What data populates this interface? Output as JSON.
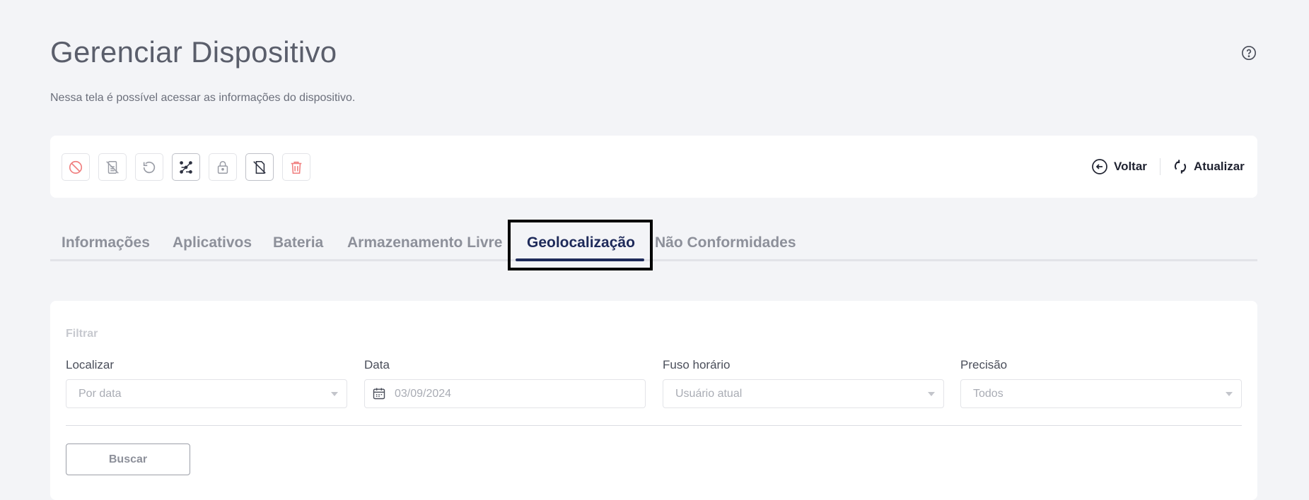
{
  "header": {
    "title": "Gerenciar Dispositivo",
    "subtitle": "Nessa tela é possível acessar as informações do dispositivo.",
    "help_icon": "question-circle-icon"
  },
  "toolbar": {
    "actions": [
      {
        "icon": "block-icon",
        "color": "#f07f7f"
      },
      {
        "icon": "device-off-icon",
        "color": "#9a9da6"
      },
      {
        "icon": "undo-icon",
        "color": "#9a9da6"
      },
      {
        "icon": "pattern-icon",
        "color": "#2d3140"
      },
      {
        "icon": "lock-icon",
        "color": "#9a9da6"
      },
      {
        "icon": "sim-off-icon",
        "color": "#2d3140"
      },
      {
        "icon": "trash-icon",
        "color": "#f07f7f"
      }
    ],
    "back_label": "Voltar",
    "refresh_label": "Atualizar"
  },
  "tabs": [
    {
      "label": "Informações",
      "active": false
    },
    {
      "label": "Aplicativos",
      "active": false
    },
    {
      "label": "Bateria",
      "active": false
    },
    {
      "label": "Armazenamento Livre",
      "active": false
    },
    {
      "label": "Geolocalização",
      "active": true
    },
    {
      "label": "Não Conformidades",
      "active": false
    }
  ],
  "filter": {
    "heading": "Filtrar",
    "fields": [
      {
        "label": "Localizar",
        "value": "Por data"
      },
      {
        "label": "Data",
        "value": "03/09/2024"
      },
      {
        "label": "Fuso horário",
        "value": "Usuário atual"
      },
      {
        "label": "Precisão",
        "value": "Todos"
      }
    ],
    "search_label": "Buscar"
  },
  "colors": {
    "accent": "#1e2a5a",
    "danger": "#f07f7f",
    "background": "#f3f4f7"
  }
}
